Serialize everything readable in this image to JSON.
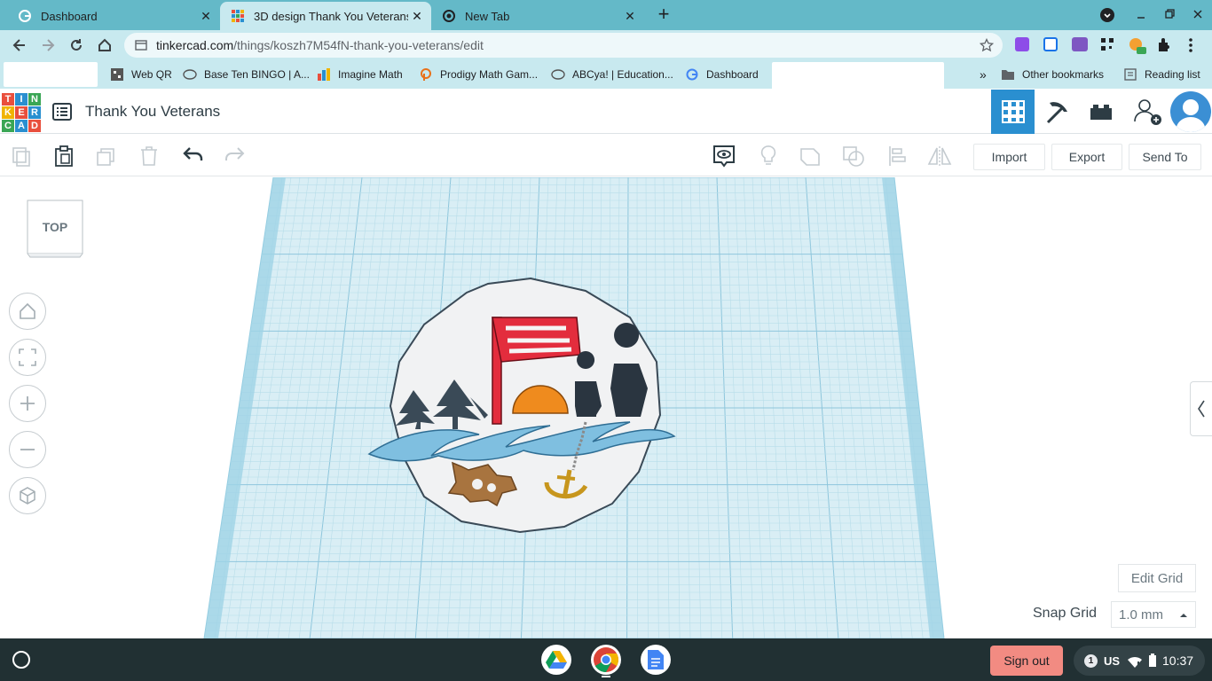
{
  "browser": {
    "tabs": [
      {
        "title": "Dashboard",
        "icon": "google-g-icon",
        "active": false
      },
      {
        "title": "3D design Thank You Veterans |",
        "icon": "tinkercad-icon",
        "active": true
      },
      {
        "title": "New Tab",
        "icon": "chrome-icon",
        "active": false
      }
    ],
    "new_tab": "+",
    "url_host": "tinkercad.com",
    "url_path": "/things/koszh7M54fN-thank-you-veterans/edit",
    "bookmarks": [
      {
        "label": "Web QR",
        "icon": "qr-icon"
      },
      {
        "label": "Base Ten BINGO | A...",
        "icon": "bingo-icon"
      },
      {
        "label": "Imagine Math",
        "icon": "imagine-math-icon"
      },
      {
        "label": "Prodigy Math Gam...",
        "icon": "prodigy-icon"
      },
      {
        "label": "ABCya! | Education...",
        "icon": "abcya-icon"
      },
      {
        "label": "Dashboard",
        "icon": "google-g-icon"
      }
    ],
    "bookmarks_overflow": "»",
    "other_bookmarks": "Other bookmarks",
    "reading_list": "Reading list"
  },
  "tinkercad": {
    "logo_letters": [
      "T",
      "I",
      "N",
      "K",
      "E",
      "R",
      "C",
      "A",
      "D"
    ],
    "design_title": "Thank You Veterans",
    "toolbar": {
      "import_label": "Import",
      "export_label": "Export",
      "send_to_label": "Send To"
    },
    "view_cube_label": "TOP",
    "edit_grid_label": "Edit Grid",
    "snap_grid_label": "Snap Grid",
    "snap_grid_value": "1.0 mm"
  },
  "shelf": {
    "sign_out_label": "Sign out",
    "notification_count": "1",
    "ime": "US",
    "time": "10:37"
  },
  "colors": {
    "tab_bar": "#64b9c8",
    "toolbar": "#c8e9ef",
    "tinkercad_blue": "#2a8fd0",
    "shelf": "#213033",
    "sign_out": "#f28b82"
  }
}
